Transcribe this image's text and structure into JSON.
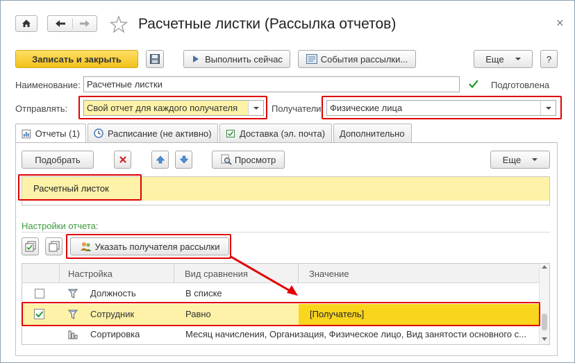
{
  "window": {
    "title": "Расчетные листки (Рассылка отчетов)",
    "close_glyph": "×"
  },
  "toolbar": {
    "save_close": "Записать и закрыть",
    "run_now": "Выполнить сейчас",
    "events": "События рассылки...",
    "more": "Еще",
    "help": "?"
  },
  "form": {
    "name_label": "Наименование:",
    "name_value": "Расчетные листки",
    "prepared_label": "Подготовлена",
    "send_label": "Отправлять:",
    "send_value": "Свой отчет для каждого получателя",
    "recipients_label": "Получатели:",
    "recipients_value": "Физические лица"
  },
  "tabs": [
    {
      "label": "Отчеты (1)"
    },
    {
      "label": "Расписание (не активно)"
    },
    {
      "label": "Доставка (эл. почта)"
    },
    {
      "label": "Дополнительно"
    }
  ],
  "reports": {
    "pick": "Подобрать",
    "preview": "Просмотр",
    "more": "Еще",
    "items": [
      "Расчетный листок"
    ]
  },
  "settings": {
    "title": "Настройки отчета:",
    "set_recipient": "Указать получателя рассылки",
    "columns": [
      "Настройка",
      "Вид сравнения",
      "Значение"
    ],
    "rows": [
      {
        "name": "Должность",
        "comparison": "В списке",
        "value": "",
        "checked": false
      },
      {
        "name": "Сотрудник",
        "comparison": "Равно",
        "value": "[Получатель]",
        "checked": true
      },
      {
        "name": "Сортировка",
        "comparison": "Месяц начисления, Организация, Физическое лицо, Вид занятости основного с...",
        "value": "",
        "checked": null
      }
    ]
  },
  "colors": {
    "accent_button": "#f5cc2a",
    "highlight": "#fdf2a8",
    "value_highlight": "#f9d51e",
    "green_label": "#3c9a3c",
    "red_annotation": "#e00000"
  }
}
